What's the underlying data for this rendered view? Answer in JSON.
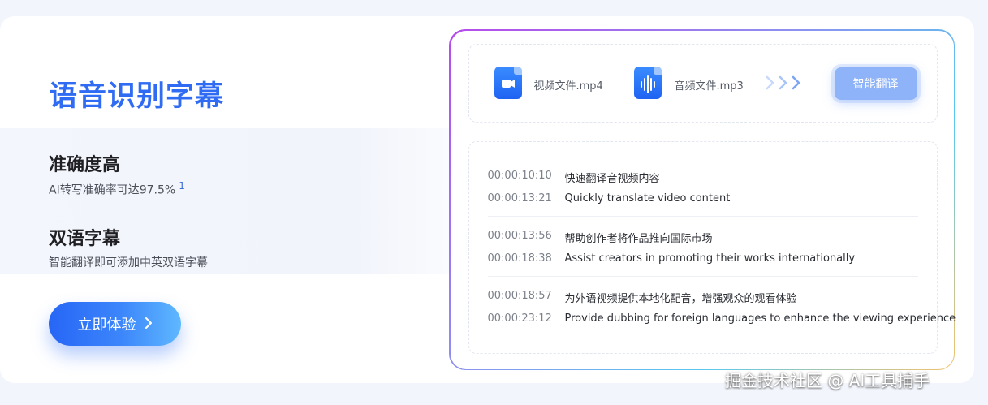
{
  "hero": {
    "title": "语音识别字幕",
    "features": [
      {
        "title": "准确度高",
        "desc": "AI转写准确率可达97.5%",
        "footnote": "1"
      },
      {
        "title": "双语字幕",
        "desc": "智能翻译即可添加中英双语字幕"
      }
    ],
    "cta_label": "立即体验",
    "cta_icon": "chevron-right-icon"
  },
  "panel": {
    "files": [
      {
        "name": "视频文件.mp4",
        "icon": "video-file-icon"
      },
      {
        "name": "音频文件.mp3",
        "icon": "audio-file-icon"
      }
    ],
    "arrows_icon": "triple-chevron-right-icon",
    "translate_label": "智能翻译",
    "subtitles": [
      {
        "time": "00:00:10:10",
        "text": "快速翻译音视频内容"
      },
      {
        "time": "00:00:13:21",
        "text": "Quickly translate video content"
      },
      {
        "time": "00:00:13:56",
        "text": "帮助创作者将作品推向国际市场"
      },
      {
        "time": "00:00:18:38",
        "text": "Assist creators in promoting their works internationally"
      },
      {
        "time": "00:00:18:57",
        "text": "为外语视频提供本地化配音，增强观众的观看体验"
      },
      {
        "time": "00:00:23:12",
        "text": "Provide dubbing for foreign languages to enhance the viewing experience"
      }
    ]
  },
  "watermark": "掘金技术社区 @ AI工具捕手",
  "colors": {
    "accent": "#2f6bf3",
    "button_gradient_start": "#2766f6",
    "button_gradient_end": "#5fb8ff",
    "translate_button": "#8fb3f9"
  }
}
